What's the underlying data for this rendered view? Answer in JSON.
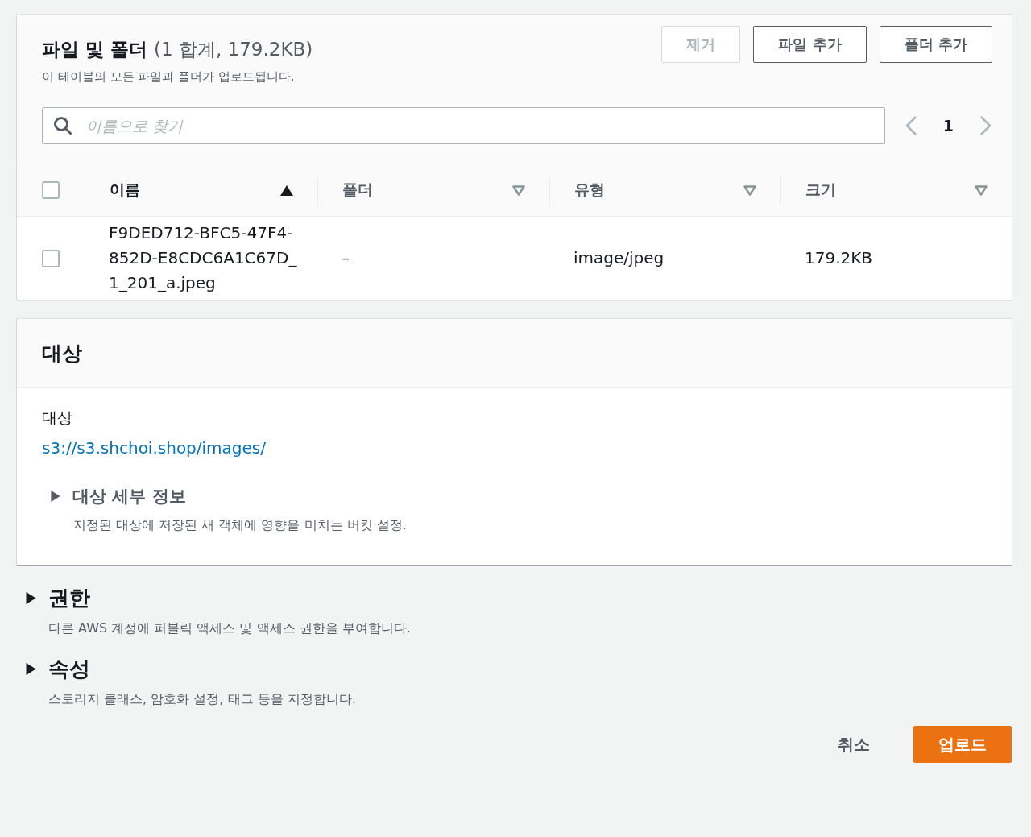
{
  "files_panel": {
    "title": "파일 및 폴더",
    "count": "(1 합계, 179.2KB)",
    "description": "이 테이블의 모든 파일과 폴더가 업로드됩니다.",
    "actions": [
      {
        "label": "제거",
        "disabled": true
      },
      {
        "label": "파일 추가",
        "disabled": false
      },
      {
        "label": "폴더 추가",
        "disabled": false
      }
    ],
    "search": {
      "placeholder": "이름으로 찾기"
    },
    "pagination": {
      "page": "1"
    },
    "select_all": {
      "checked": false
    },
    "columns": [
      {
        "label": "이름",
        "sorted": true
      },
      {
        "label": "폴더",
        "sorted": false
      },
      {
        "label": "유형",
        "sorted": false
      },
      {
        "label": "크기",
        "sorted": false
      }
    ],
    "rows": [
      {
        "checked": false,
        "cells": [
          "F9DED712-BFC5-47F4-852D-E8CDC6A1C67D_1_201_a.jpeg",
          "–",
          "image/jpeg",
          "179.2KB"
        ]
      }
    ]
  },
  "destination_panel": {
    "title": "대상",
    "label": "대상",
    "link": "s3://s3.shchoi.shop/images/",
    "details": {
      "title": "대상 세부 정보",
      "description": "지정된 대상에 저장된 새 객체에 영향을 미치는 버킷 설정.",
      "expanded": false
    }
  },
  "sections": [
    {
      "title": "권한",
      "description": "다른 AWS 계정에 퍼블릭 액세스 및 액세스 권한을 부여합니다.",
      "expanded": false
    },
    {
      "title": "속성",
      "description": "스토리지 클래스, 암호화 설정, 태그 등을 지정합니다.",
      "expanded": false
    }
  ],
  "footer": {
    "cancel": "취소",
    "submit": "업로드"
  }
}
